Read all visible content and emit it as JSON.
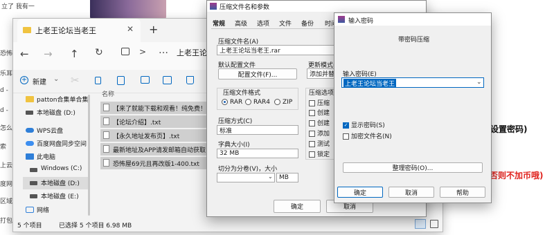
{
  "background": {
    "left_text": [
      "立了 我有一",
      "恐怖",
      "乐耳",
      "d -",
      "d -",
      "怎么",
      "索",
      "上云",
      "度网",
      "区域",
      "打包"
    ],
    "right_red": "否则不加币哦)",
    "right_black": "设置密码)"
  },
  "explorer": {
    "tab_title": "上老王论坛当老王",
    "new_tab": "+",
    "address_sep": ">",
    "address": "上老王论坛",
    "new_button": "新建",
    "sidebar": [
      {
        "label": "patton合集单合集",
        "icon": "folder-icon"
      },
      {
        "label": "本地磁盘 (D:)",
        "icon": "drive-icon"
      },
      {
        "label": "WPS云盘",
        "icon": "cloud-icon"
      },
      {
        "label": "百度网盘同步空间",
        "icon": "cloud-icon"
      },
      {
        "label": "此电脑",
        "icon": "computer-icon"
      },
      {
        "label": "Windows (C:)",
        "icon": "drive-icon"
      },
      {
        "label": "本地磁盘 (D:)",
        "icon": "drive-icon"
      },
      {
        "label": "本地磁盘 (E:)",
        "icon": "drive-icon"
      },
      {
        "label": "网络",
        "icon": "network-icon"
      }
    ],
    "column_header": "名称",
    "files": [
      "【来了就能下载和观看！纯免费！",
      "【论坛介绍】.txt",
      "【永久地址发布页】.txt",
      "最新地址及APP请发邮箱自动获取",
      "恐怖屋69元且再改版1-400.txt"
    ],
    "status_count": "5 个项目",
    "status_selected": "已选择 5 个项目  6.98 MB"
  },
  "archive_dialog": {
    "title": "压缩文件名和参数",
    "tabs": [
      "常规",
      "高级",
      "选项",
      "文件",
      "备份",
      "时间"
    ],
    "name_label": "压缩文件名(A)",
    "name_value": "上老王论坛当老王.rar",
    "default_profile_label": "默认配置文件",
    "profile_button": "配置文件(F)...",
    "update_label": "更新模式(",
    "update_value": "添加并替",
    "format_label": "压缩文件格式",
    "formats": [
      "RAR",
      "RAR4",
      "ZIP"
    ],
    "method_label": "压缩方式(C)",
    "method_value": "标准",
    "dict_label": "字典大小(I)",
    "dict_value": "32 MB",
    "split_label": "切分为分卷(V)，大小",
    "split_unit": "MB",
    "options_label": "压缩选项",
    "options": [
      "压缩",
      "创建",
      "创建",
      "添加",
      "测试",
      "锁定"
    ],
    "ok": "确定",
    "cancel": "取消"
  },
  "password_dialog": {
    "title": "输入密码",
    "subtitle": "带密码压缩",
    "input_label": "输入密码(E)",
    "password_value": "上老王论坛当老王",
    "show_password": "显示密码(S)",
    "show_password_checked": true,
    "encrypt_names": "加密文件名(N)",
    "encrypt_names_checked": false,
    "organize_button": "整理密码(O)...",
    "ok": "确定",
    "cancel": "取消",
    "help": "帮助"
  },
  "colors": {
    "accent": "#0067c0",
    "selection": "#cde4f7",
    "red_text": "#e0241f"
  }
}
